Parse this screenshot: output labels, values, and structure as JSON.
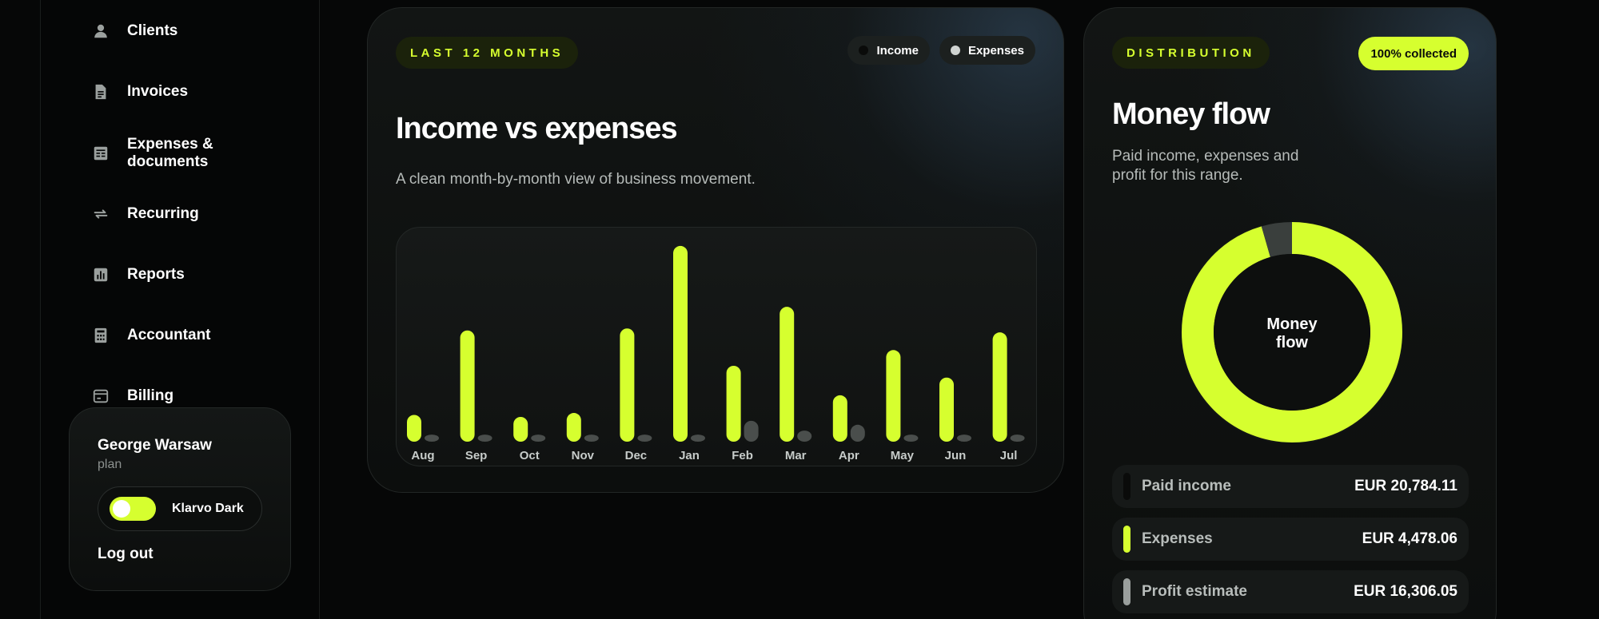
{
  "sidebar": {
    "items": [
      {
        "label": "Clients",
        "icon": "user-icon"
      },
      {
        "label": "Invoices",
        "icon": "document-icon"
      },
      {
        "label": "Expenses & documents",
        "icon": "table-icon"
      },
      {
        "label": "Recurring",
        "icon": "repeat-icon"
      },
      {
        "label": "Reports",
        "icon": "report-icon"
      },
      {
        "label": "Accountant",
        "icon": "calculator-icon"
      },
      {
        "label": "Billing",
        "icon": "billing-icon"
      }
    ],
    "user": {
      "name": "George Warsaw",
      "plan": "plan",
      "theme_label": "Klarvo Dark",
      "theme_on": true,
      "logout": "Log out"
    }
  },
  "chart_card": {
    "tag": "LAST 12 MONTHS",
    "title": "Income vs expenses",
    "subtitle": "A clean month-by-month view of business movement.",
    "legend": [
      {
        "label": "Income",
        "color": "#0a0b0a"
      },
      {
        "label": "Expenses",
        "color": "#cfd3d1"
      }
    ]
  },
  "chart_data": {
    "type": "bar",
    "categories": [
      "Aug",
      "Sep",
      "Oct",
      "Nov",
      "Dec",
      "Jan",
      "Feb",
      "Mar",
      "Apr",
      "May",
      "Jun",
      "Jul"
    ],
    "series": [
      {
        "name": "Income",
        "color": "#d6ff2f",
        "values": [
          12,
          55,
          11,
          13,
          56,
          98,
          37,
          67,
          22,
          45,
          31,
          54
        ]
      },
      {
        "name": "Expenses",
        "color": "#4a4e4c",
        "values": [
          2,
          2,
          2,
          2,
          2,
          2,
          9,
          4,
          7,
          2,
          2,
          2
        ]
      }
    ],
    "ylim": [
      0,
      100
    ],
    "grid": false
  },
  "distribution_card": {
    "tag": "DISTRIBUTION",
    "badge": "100% collected",
    "title": "Money flow",
    "subtitle": "Paid income, expenses and profit for this range.",
    "donut_center": [
      "Money",
      "flow"
    ],
    "donut_segments": [
      {
        "name": "Paid income",
        "share": 0.955,
        "color": "#d6ff2f"
      },
      {
        "name": "Expenses",
        "share": 0.045,
        "color": "#3a3f3d"
      }
    ],
    "rows": [
      {
        "label": "Paid income",
        "value": "EUR 20,784.11",
        "color": "#0a0b0a"
      },
      {
        "label": "Expenses",
        "value": "EUR 4,478.06",
        "color": "#d6ff2f"
      },
      {
        "label": "Profit estimate",
        "value": "EUR 16,306.05",
        "color": "#9a9f9d"
      }
    ]
  }
}
